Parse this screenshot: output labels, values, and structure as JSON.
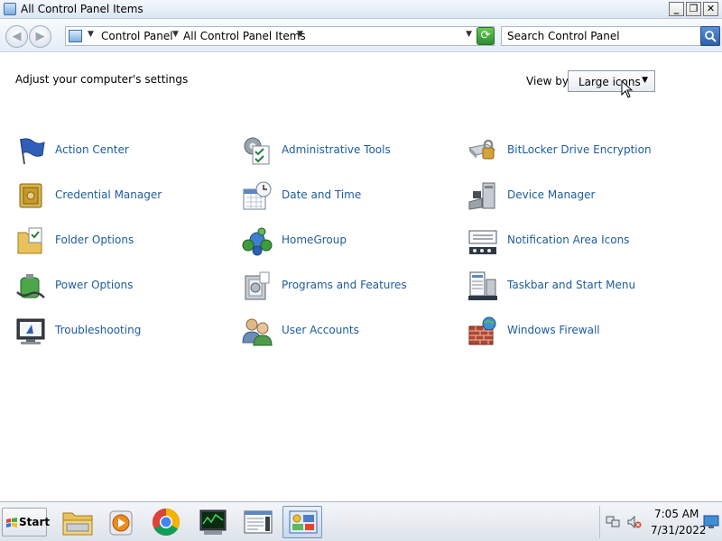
{
  "window": {
    "title": "All Control Panel Items",
    "minimize_glyph": "_",
    "maximize_glyph": "❐",
    "close_glyph": "✕"
  },
  "address": {
    "crumbs": [
      "Control Panel",
      "All Control Panel Items"
    ],
    "search_placeholder": "Search Control Panel"
  },
  "main": {
    "heading": "Adjust your computer's settings",
    "view_by_label": "View by:",
    "view_by_value": "Large icons"
  },
  "items": [
    {
      "label": "Action Center",
      "icon": "action-center-flag-icon"
    },
    {
      "label": "Administrative Tools",
      "icon": "administrative-tools-icon"
    },
    {
      "label": "BitLocker Drive Encryption",
      "icon": "bitlocker-drive-icon"
    },
    {
      "label": "Credential Manager",
      "icon": "credential-manager-vault-icon"
    },
    {
      "label": "Date and Time",
      "icon": "date-time-calendar-icon"
    },
    {
      "label": "Device Manager",
      "icon": "device-manager-icon"
    },
    {
      "label": "Folder Options",
      "icon": "folder-options-icon"
    },
    {
      "label": "HomeGroup",
      "icon": "homegroup-icon"
    },
    {
      "label": "Notification Area Icons",
      "icon": "notification-area-icon"
    },
    {
      "label": "Power Options",
      "icon": "power-options-battery-icon"
    },
    {
      "label": "Programs and Features",
      "icon": "programs-features-icon"
    },
    {
      "label": "Taskbar and Start Menu",
      "icon": "taskbar-start-menu-icon"
    },
    {
      "label": "Troubleshooting",
      "icon": "troubleshooting-monitor-icon"
    },
    {
      "label": "User Accounts",
      "icon": "user-accounts-icon"
    },
    {
      "label": "Windows Firewall",
      "icon": "windows-firewall-icon"
    }
  ],
  "taskbar": {
    "start_label": "Start",
    "apps": [
      "file-explorer-icon",
      "media-player-icon",
      "chrome-icon",
      "task-manager-icon",
      "notepad-window-icon",
      "control-panel-icon"
    ],
    "clock_time": "7:05 AM",
    "clock_date": "7/31/2022"
  },
  "colors": {
    "link": "#1e5b9e",
    "titlebar": "#dbe6f3",
    "taskbar": "#dde3ea"
  }
}
